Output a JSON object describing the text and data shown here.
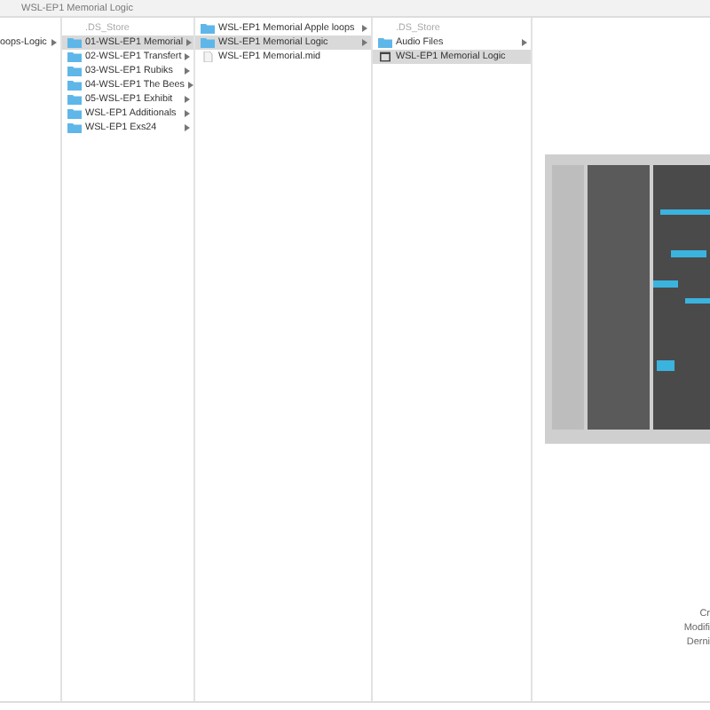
{
  "window": {
    "title": "WSL-EP1 Memorial Logic"
  },
  "columns": [
    {
      "items": [
        {
          "name": "oops-Logic",
          "kind": "none",
          "arrow": true,
          "selected": false,
          "dimmed": false
        }
      ]
    },
    {
      "items": [
        {
          "name": ".DS_Store",
          "kind": "blank",
          "arrow": false,
          "selected": false,
          "dimmed": true
        },
        {
          "name": "01-WSL-EP1 Memorial",
          "kind": "folder",
          "arrow": true,
          "selected": true,
          "dimmed": false
        },
        {
          "name": "02-WSL-EP1 Transfert",
          "kind": "folder",
          "arrow": true,
          "selected": false,
          "dimmed": false
        },
        {
          "name": "03-WSL-EP1 Rubiks",
          "kind": "folder",
          "arrow": true,
          "selected": false,
          "dimmed": false
        },
        {
          "name": "04-WSL-EP1 The Bees",
          "kind": "folder",
          "arrow": true,
          "selected": false,
          "dimmed": false
        },
        {
          "name": "05-WSL-EP1 Exhibit",
          "kind": "folder",
          "arrow": true,
          "selected": false,
          "dimmed": false
        },
        {
          "name": "WSL-EP1 Additionals",
          "kind": "folder",
          "arrow": true,
          "selected": false,
          "dimmed": false
        },
        {
          "name": "WSL-EP1 Exs24",
          "kind": "folder",
          "arrow": true,
          "selected": false,
          "dimmed": false
        }
      ]
    },
    {
      "items": [
        {
          "name": "WSL-EP1 Memorial Apple loops",
          "kind": "folder",
          "arrow": true,
          "selected": false,
          "dimmed": false
        },
        {
          "name": "WSL-EP1 Memorial Logic",
          "kind": "folder",
          "arrow": true,
          "selected": true,
          "dimmed": false
        },
        {
          "name": "WSL-EP1 Memorial.mid",
          "kind": "midi",
          "arrow": false,
          "selected": false,
          "dimmed": false
        }
      ]
    },
    {
      "items": [
        {
          "name": ".DS_Store",
          "kind": "blank",
          "arrow": false,
          "selected": false,
          "dimmed": true
        },
        {
          "name": "Audio Files",
          "kind": "folder",
          "arrow": true,
          "selected": false,
          "dimmed": false
        },
        {
          "name": "WSL-EP1 Memorial Logic",
          "kind": "project",
          "arrow": false,
          "selected": true,
          "dimmed": false
        }
      ]
    }
  ],
  "preview": {
    "info_labels": [
      "Cr",
      "Modifi",
      "Derni"
    ]
  }
}
